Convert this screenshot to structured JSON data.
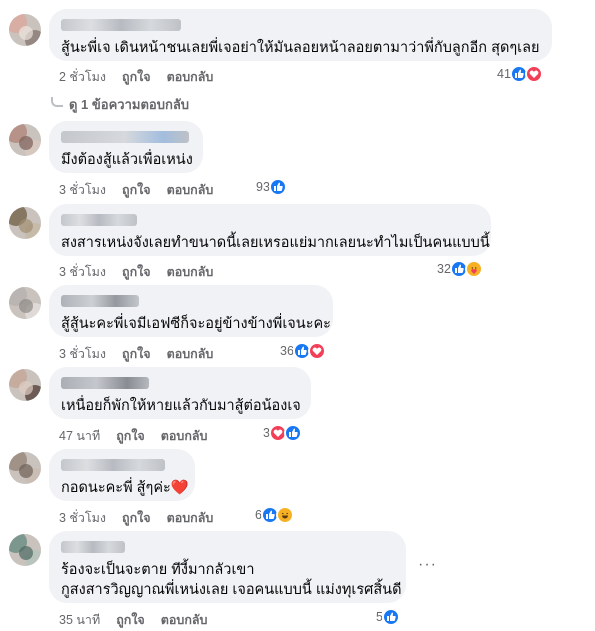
{
  "actions": {
    "like": "ถูกใจ",
    "reply": "ตอบกลับ"
  },
  "view_replies": "ดู 1 ข้อความตอบกลับ",
  "more_options": "···",
  "colors": {
    "like": "#1877f2",
    "love": "#f33e58",
    "care": "#f7b125",
    "bubble": "#f0f2f5",
    "meta": "#65676b"
  },
  "comments": [
    {
      "lines": [
        "สู้นะพี่เจ เดินหน้าชนเลยพี่เจอย่าให้มันลอยหน้าลอยตามาว่าพี่กับลูกอีก สุดๆเลย"
      ],
      "time": "2 ชั่วโมง",
      "count": "41",
      "reactions": [
        "like",
        "love"
      ]
    },
    {
      "lines": [
        "มึงต้องสู้แล้วเพื่อเหน่ง"
      ],
      "time": "3 ชั่วโมง",
      "count": "93",
      "reactions": [
        "like"
      ]
    },
    {
      "lines": [
        "สงสารเหน่งจังเลยทำขนาดนี้เลยเหรอแย่มากเลยนะทำไมเป็นคนแบบนี้"
      ],
      "time": "3 ชั่วโมง",
      "count": "32",
      "reactions": [
        "like",
        "care"
      ]
    },
    {
      "lines": [
        "สู้สู้นะคะพี่เจมีเอฟซีก็จะอยู่ข้างข้างพี่เจนะคะ"
      ],
      "time": "3 ชั่วโมง",
      "count": "36",
      "reactions": [
        "like",
        "love"
      ]
    },
    {
      "lines": [
        "เหนื่อยก็พักให้หายแล้วกับมาสู้ต่อน้องเจ"
      ],
      "time": "47 นาที",
      "count": "3",
      "reactions": [
        "love",
        "like"
      ]
    },
    {
      "lines": [
        "กอดนะคะพี่ สู้ๆค่ะ"
      ],
      "heart": "❤️",
      "time": "3 ชั่วโมง",
      "count": "6",
      "reactions": [
        "like",
        "haha"
      ]
    },
    {
      "lines": [
        "ร้องจะเป็นจะตาย ทีงี้มากลัวเขา",
        "กูสงสารวิญญาณพี่เหน่งเลย เจอคนแบบนี้ แม่งทุเรศสิ้นดี"
      ],
      "time": "35 นาที",
      "count": "5",
      "reactions": [
        "like"
      ]
    }
  ]
}
